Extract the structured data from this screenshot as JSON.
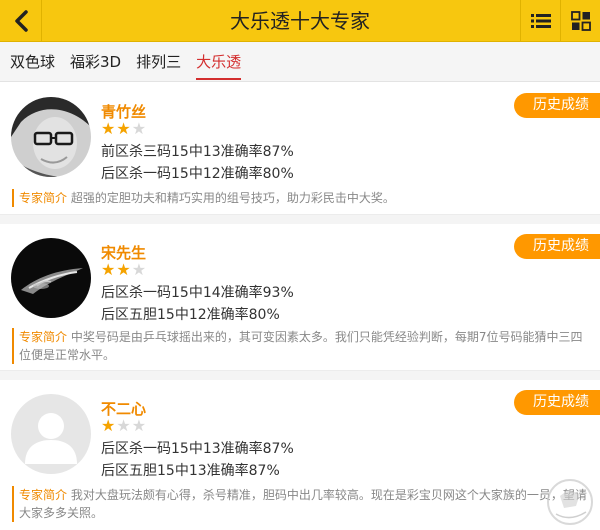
{
  "header": {
    "title": "大乐透十大专家",
    "back_icon": "chevron-left-icon",
    "list_icon": "list-icon",
    "grid_icon": "grid-icon",
    "accent_color": "#f7c70f"
  },
  "tabs": [
    {
      "label": "双色球"
    },
    {
      "label": "福彩3D"
    },
    {
      "label": "排列三"
    },
    {
      "label": "大乐透",
      "active": true
    }
  ],
  "experts": [
    {
      "name": "青竹丝",
      "stars": 2,
      "max_stars": 3,
      "stats": [
        "前区杀三码15中13准确率87%",
        "后区杀一码15中12准确率80%"
      ],
      "history_label": "历史成绩",
      "intro_label": "专家简介",
      "intro_text": "超强的定胆功夫和精巧实用的组号技巧，助力彩民击中大奖。"
    },
    {
      "name": "宋先生",
      "stars": 2,
      "max_stars": 3,
      "stats": [
        "后区杀一码15中14准确率93%",
        "后区五胆15中12准确率80%"
      ],
      "history_label": "历史成绩",
      "intro_label": "专家简介",
      "intro_text": "中奖号码是由乒乓球摇出来的，其可变因素太多。我们只能凭经验判断，每期7位号码能猜中三四位便是正常水平。"
    },
    {
      "name": "不二心",
      "stars": 1,
      "max_stars": 3,
      "stats": [
        "后区杀一码15中13准确率87%",
        "后区五胆15中13准确率87%"
      ],
      "history_label": "历史成绩",
      "intro_label": "专家简介",
      "intro_text": "我对大盘玩法颇有心得，杀号精准，胆码中出几率较高。现在是彩宝贝网这个大家族的一员，望请大家多多关照。"
    }
  ],
  "colors": {
    "name": "#f08a00",
    "history_button": "#ff9800",
    "active_tab": "#d32e2e",
    "star_on": "#f5a300",
    "star_off": "#d8d8d8"
  }
}
